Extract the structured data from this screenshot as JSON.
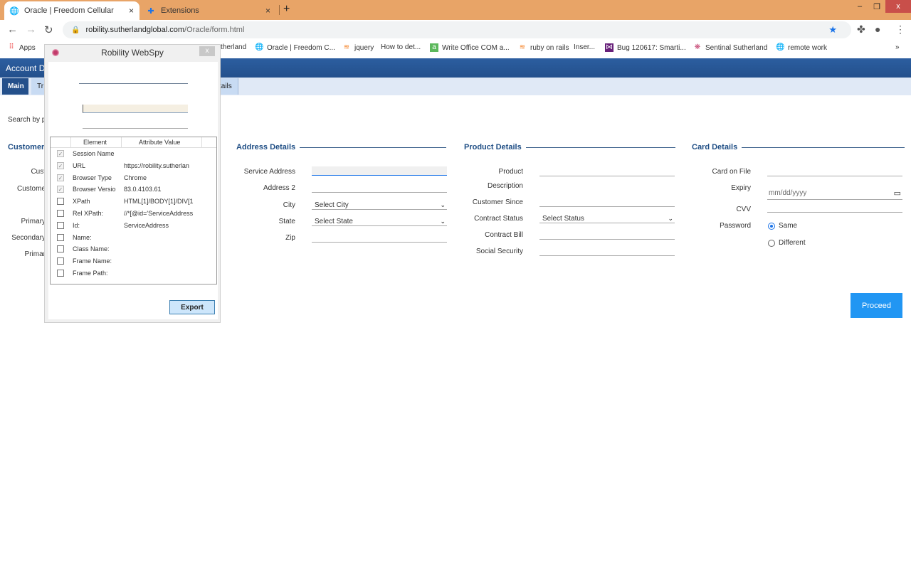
{
  "browser": {
    "tabs": [
      {
        "title": "Oracle | Freedom Cellular",
        "icon": "globe-icon",
        "active": true
      },
      {
        "title": "Extensions",
        "icon": "puzzle-icon",
        "active": false
      }
    ],
    "new_tab": "+",
    "tab_close": "×",
    "url_domain": "robility.sutherlandglobal.com",
    "url_path": "/Oracle/form.html",
    "window_controls": {
      "minimize": "–",
      "maximize": "❐",
      "close": "x"
    },
    "bookmarks": [
      {
        "label": "Apps",
        "icon": "apps-grid-icon"
      },
      {
        "label": "therland",
        "icon": ""
      },
      {
        "label": "Oracle | Freedom C...",
        "icon": "globe-icon"
      },
      {
        "label": "jquery",
        "icon": "stackoverflow-icon"
      },
      {
        "label": "How to det...",
        "icon": ""
      },
      {
        "label": "Write Office COM a...",
        "icon": "a-icon"
      },
      {
        "label": "ruby on rails",
        "icon": "stackoverflow-icon"
      },
      {
        "label": "Inser...",
        "icon": ""
      },
      {
        "label": "Bug 120617: Smarti...",
        "icon": "visualstudio-icon"
      },
      {
        "label": "Sentinal Sutherland",
        "icon": "sentinal-icon"
      },
      {
        "label": "remote work",
        "icon": "globe-icon"
      }
    ],
    "bookmarks_overflow": "»"
  },
  "app": {
    "header_title": "Account D",
    "subtabs": [
      {
        "label": "Main",
        "active": true
      },
      {
        "label": "Tr",
        "active": false
      },
      {
        "label": "tails",
        "active": false
      }
    ],
    "search_label": "Search by p",
    "customer": {
      "title": "Customer",
      "labels": [
        "Cust",
        "Custome",
        "Primary",
        "Secondary",
        "Primar"
      ]
    },
    "address": {
      "title": "Address Details",
      "fields": [
        {
          "label": "Service Address",
          "value": "",
          "type": "text"
        },
        {
          "label": "Address 2",
          "value": "",
          "type": "text"
        },
        {
          "label": "City",
          "value": "Select City",
          "type": "select"
        },
        {
          "label": "State",
          "value": "Select State",
          "type": "select"
        },
        {
          "label": "Zip",
          "value": "",
          "type": "text"
        }
      ]
    },
    "product": {
      "title": "Product Details",
      "fields": [
        {
          "label": "Product",
          "value": ""
        },
        {
          "label": "Description",
          "value": ""
        },
        {
          "label": "Customer Since",
          "value": ""
        },
        {
          "label": "Contract Status",
          "value": "Select Status"
        },
        {
          "label": "Contract Bill",
          "value": ""
        },
        {
          "label": "Social Security",
          "value": ""
        }
      ]
    },
    "card": {
      "title": "Card Details",
      "fields": [
        {
          "label": "Card on File",
          "value": ""
        },
        {
          "label": "Expiry",
          "value": "mm/dd/yyyy"
        },
        {
          "label": "CVV",
          "value": ""
        },
        {
          "label": "Password",
          "value": ""
        }
      ],
      "password_options": [
        {
          "label": "Same",
          "selected": true
        },
        {
          "label": "Different",
          "selected": false
        }
      ]
    },
    "proceed_label": "Proceed",
    "accent_color": "#2196f3"
  },
  "webspy": {
    "title": "Robility WebSpy",
    "close": "x",
    "columns": [
      "Element",
      "Attribute Value"
    ],
    "rows": [
      {
        "name": "Session Name",
        "value": "",
        "checked": true
      },
      {
        "name": "URL",
        "value": "https://robility.sutherlan",
        "checked": true
      },
      {
        "name": "Browser Type",
        "value": "Chrome",
        "checked": true
      },
      {
        "name": "Browser Versio",
        "value": "83.0.4103.61",
        "checked": true
      },
      {
        "name": "XPath",
        "value": "HTML[1]/BODY[1]/DIV[1",
        "checked": false
      },
      {
        "name": "Rel XPath:",
        "value": "//*[@id='ServiceAddress",
        "checked": false
      },
      {
        "name": "Id:",
        "value": "ServiceAddress",
        "checked": false
      },
      {
        "name": "Name:",
        "value": "",
        "checked": false
      },
      {
        "name": "Class Name:",
        "value": "",
        "checked": false
      },
      {
        "name": "Frame Name:",
        "value": "",
        "checked": false
      },
      {
        "name": "Frame Path:",
        "value": "",
        "checked": false
      }
    ],
    "export_label": "Export"
  }
}
